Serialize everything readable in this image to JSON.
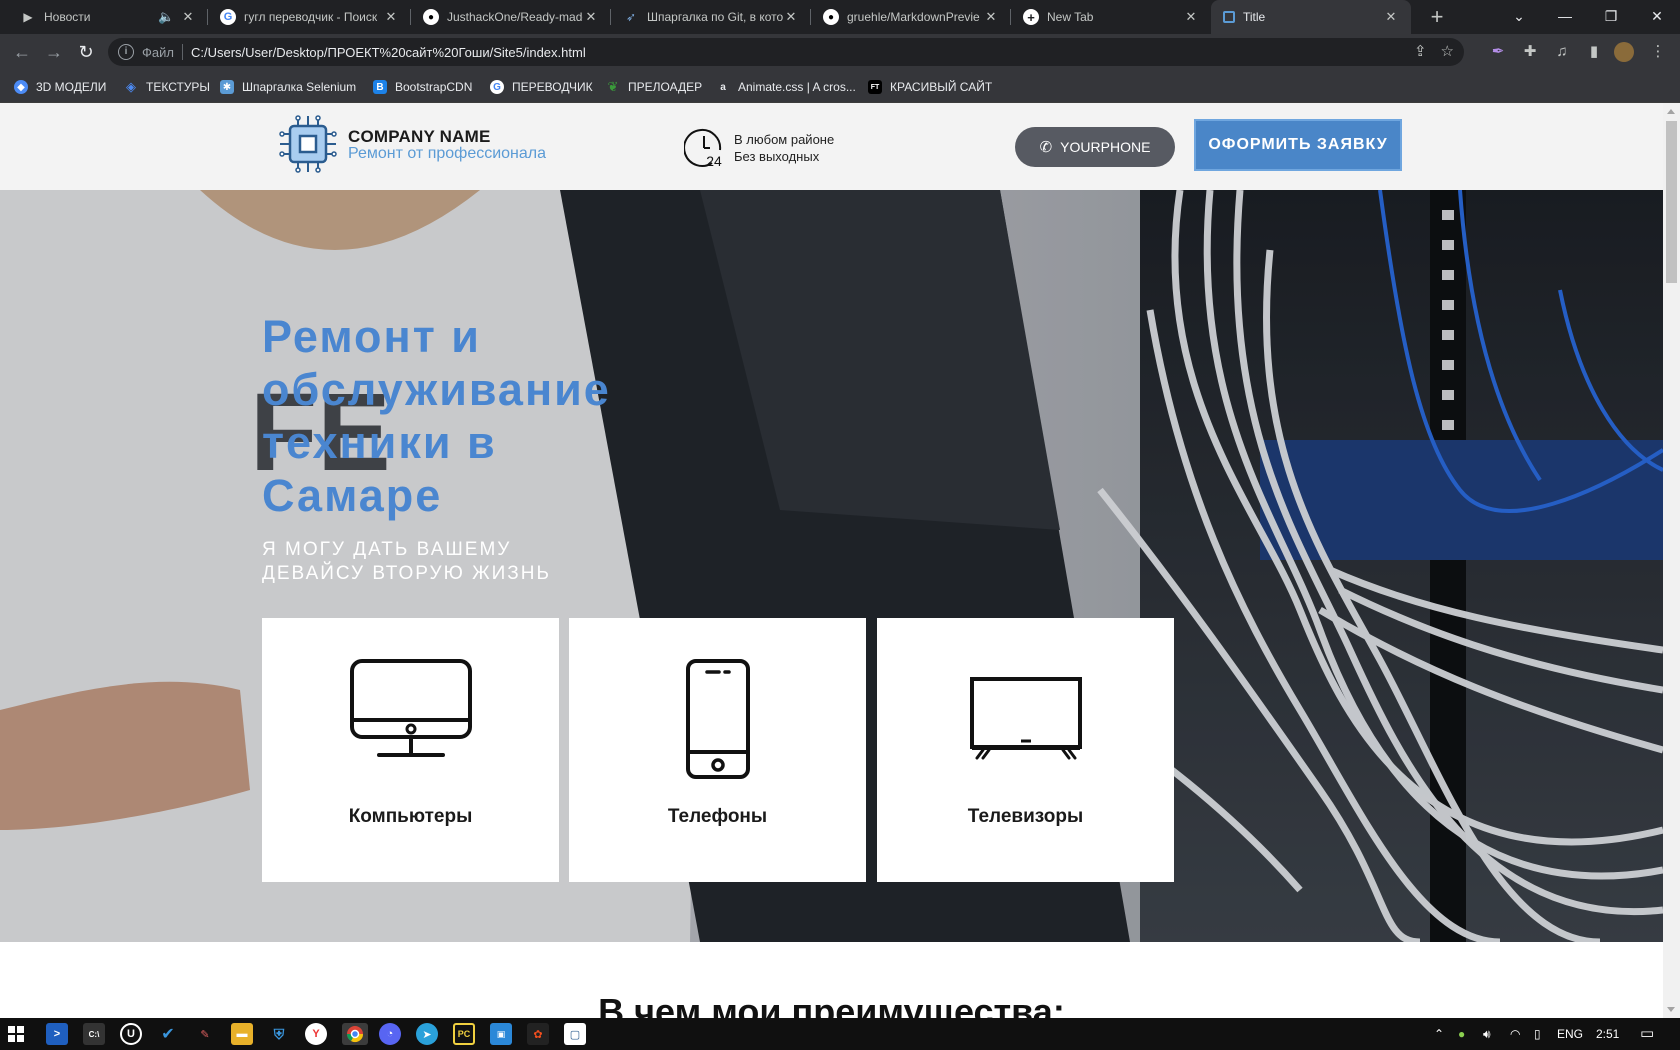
{
  "browser": {
    "tabs": [
      {
        "label": "Новости",
        "favicon": "play-icon"
      },
      {
        "label": "гугл переводчик - Поиск",
        "favicon": "google-icon"
      },
      {
        "label": "JusthackOne/Ready-made",
        "favicon": "github-icon"
      },
      {
        "label": "Шпаргалка по Git, в кото",
        "favicon": "git-icon"
      },
      {
        "label": "gruehle/MarkdownPrevie",
        "favicon": "github-icon"
      },
      {
        "label": "New Tab",
        "favicon": "plus-circle-icon"
      },
      {
        "label": "Title",
        "favicon": "page-icon"
      }
    ],
    "active_tab": "Title",
    "address_scheme": "Файл",
    "url": "C:/Users/User/Desktop/ПРОЕКТ%20сайт%20Гоши/Site5/index.html",
    "bookmarks": [
      {
        "label": "3D МОДЕЛИ",
        "icon": "cube-icon",
        "color": "#4c8bf5"
      },
      {
        "label": "ТЕКСТУРЫ",
        "icon": "cube-icon",
        "color": "#4c8bf5"
      },
      {
        "label": "Шпаргалка Selenium",
        "icon": "selenium-icon",
        "color": "#5b9bd5"
      },
      {
        "label": "BootstrapCDN",
        "icon": "bootstrap-icon",
        "color": "#1d82e8"
      },
      {
        "label": "ПЕРЕВОДЧИК",
        "icon": "google-icon",
        "color": "#ffffff"
      },
      {
        "label": "ПРЕЛОАДЕР",
        "icon": "leaf-icon",
        "color": "#3a9a3a"
      },
      {
        "label": "Animate.css | A cros...",
        "icon": "animate-icon",
        "color": "#222222"
      },
      {
        "label": "КРАСИВЫЙ САЙТ",
        "icon": "ft-icon",
        "color": "#111111"
      }
    ]
  },
  "site": {
    "company_name": "COMPANY NAME",
    "company_tagline": "Ремонт от профессионала",
    "hours_line1": "В любом районе",
    "hours_line2": "Без выходных",
    "clock_number": "24",
    "phone_label": "YOURPHONE",
    "order_label": "ОФОРМИТЬ ЗАЯВКУ",
    "hero_title": "Ремонт и обслуживание техники в Самаре",
    "hero_subtitle": "Я могу дать вашему девайсу вторую жизнь",
    "cards": [
      {
        "label": "Компьютеры",
        "icon": "monitor-icon"
      },
      {
        "label": "Телефоны",
        "icon": "smartphone-icon"
      },
      {
        "label": "Телевизоры",
        "icon": "tv-icon"
      }
    ],
    "advantages_title": "В чем мои преимущества:"
  },
  "taskbar": {
    "language": "ENG",
    "time": "2:51"
  },
  "colors": {
    "accent": "#4a86c8",
    "title_blue": "#4a86d0",
    "header_bg": "#f3f3f3",
    "phone_btn": "#575a62"
  }
}
